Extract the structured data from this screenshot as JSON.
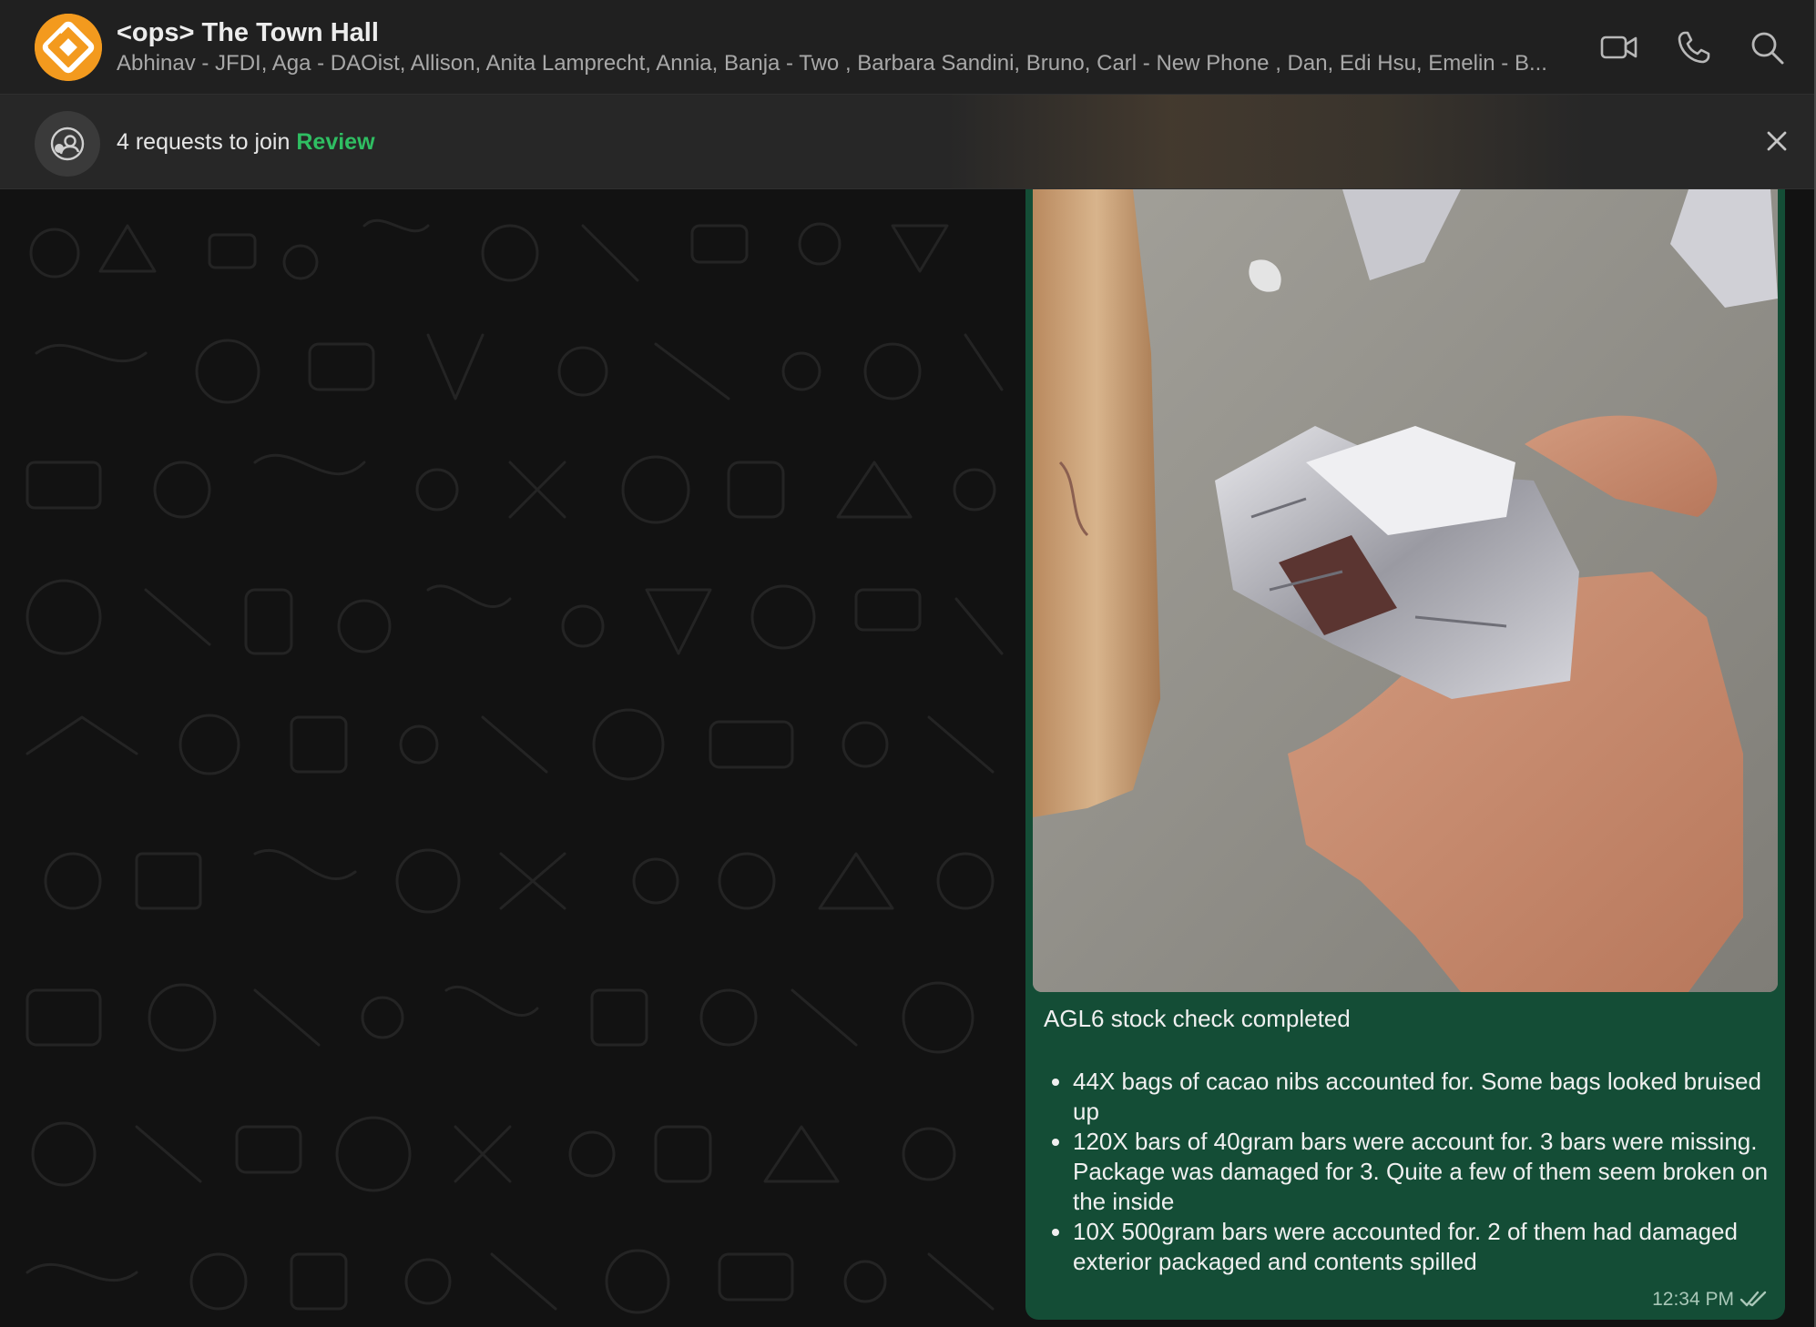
{
  "header": {
    "title": "<ops> The Town Hall",
    "members": "Abhinav - JFDI, Aga - DAOist, Allison, Anita Lamprecht, Annia, Banja - Two , Barbara Sandini, Bruno, Carl - New Phone , Dan, Edi Hsu, Emelin - B...",
    "icons": [
      "video-call-icon",
      "voice-call-icon",
      "search-icon"
    ]
  },
  "join_banner": {
    "text": "4 requests to join",
    "action": "Review"
  },
  "message": {
    "title": "AGL6 stock check completed",
    "bullets": [
      "44X bags of cacao nibs accounted for. Some bags looked bruised up",
      "120X bars of 40gram bars were account for. 3 bars were missing. Package was damaged for 3. Quite a few of them seem broken on the inside",
      "10X 500gram bars were accounted for. 2 of them had damaged exterior packaged and contents spilled"
    ],
    "time": "12:34 PM",
    "status": "read"
  },
  "colors": {
    "header_bg": "#202020",
    "banner_bg": "#272727",
    "chat_bg": "#121212",
    "bubble_bg": "#144d36",
    "accent_green": "#2fbe62",
    "avatar_orange": "#f39a1e"
  }
}
